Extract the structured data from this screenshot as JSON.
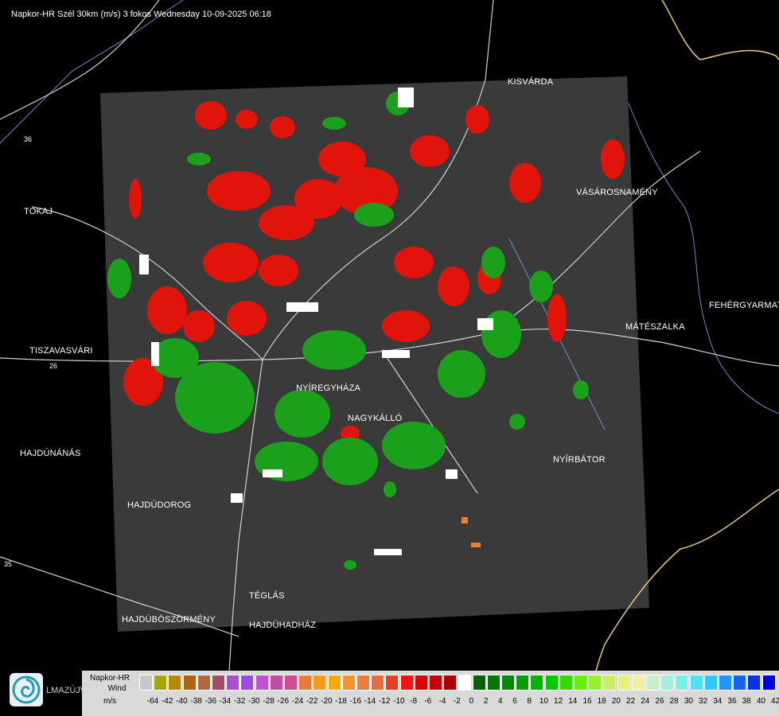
{
  "title": "Napkor-HR Szél 30km (m/s) 3 fokos Wednesday 10-09-2025 06:18",
  "cities": [
    {
      "id": "kisvarda",
      "name": "KISVÁRDA"
    },
    {
      "id": "tokaj",
      "name": "TOKAJ"
    },
    {
      "id": "vasarosnameny",
      "name": "VÁSÁROSNAMÉNY"
    },
    {
      "id": "fehergyarmat",
      "name": "FEHÉRGYARMAT"
    },
    {
      "id": "mateszalka",
      "name": "MÁTÉSZALKA"
    },
    {
      "id": "tiszavasvari",
      "name": "TISZAVASVÁRI"
    },
    {
      "id": "nyiregyhaza",
      "name": "NYÍREGYHÁZA"
    },
    {
      "id": "nagykallo",
      "name": "NAGYKÁLLÓ"
    },
    {
      "id": "hajdunanas",
      "name": "HAJDÚNÁNÁS"
    },
    {
      "id": "nyirbator",
      "name": "NYÍRBÁTOR"
    },
    {
      "id": "hajdudorog",
      "name": "HAJDÚDOROG"
    },
    {
      "id": "teglas",
      "name": "TÉGLÁS"
    },
    {
      "id": "hajduboszormeny",
      "name": "HAJDÚBÖSZÖRMÉNY"
    },
    {
      "id": "hajduhadhaz",
      "name": "HAJDÚHADHÁZ"
    }
  ],
  "road_labels": [
    "36",
    "26",
    "35"
  ],
  "logo_text": "LMAZÚJVÁR",
  "legend": {
    "line1": "Napkor-HR",
    "line2": "Wind",
    "line3": "m/s",
    "ticks": [
      "-64",
      "-42",
      "-40",
      "-38",
      "-36",
      "-34",
      "-32",
      "-30",
      "-28",
      "-26",
      "-24",
      "-22",
      "-20",
      "-18",
      "-16",
      "-14",
      "-12",
      "-10",
      "-8",
      "-6",
      "-4",
      "-2",
      "0",
      "2",
      "4",
      "6",
      "8",
      "10",
      "12",
      "14",
      "16",
      "18",
      "20",
      "22",
      "24",
      "26",
      "28",
      "30",
      "32",
      "34",
      "36",
      "38",
      "40",
      "42"
    ],
    "colors": [
      "#c8c8c8",
      "#a6a600",
      "#b98a00",
      "#b36400",
      "#b26a3c",
      "#a84c66",
      "#b04cd0",
      "#9b4ce0",
      "#c050d0",
      "#c64ca0",
      "#d04c90",
      "#e87a3c",
      "#f29a1a",
      "#f8a800",
      "#f4942a",
      "#ee7b3c",
      "#e86a40",
      "#ee3c1e",
      "#f01414",
      "#e00000",
      "#c80000",
      "#b00000",
      "#ffffff",
      "#006400",
      "#007800",
      "#008c00",
      "#00a000",
      "#00b400",
      "#00c800",
      "#32dc00",
      "#64ee00",
      "#96f032",
      "#c8f064",
      "#e8f07a",
      "#f0f0a0",
      "#c8f0c8",
      "#a0f0dc",
      "#78f0e8",
      "#50e0f0",
      "#30c8f8",
      "#1e96f8",
      "#1464f0",
      "#0a32e8",
      "#0000e0"
    ]
  }
}
